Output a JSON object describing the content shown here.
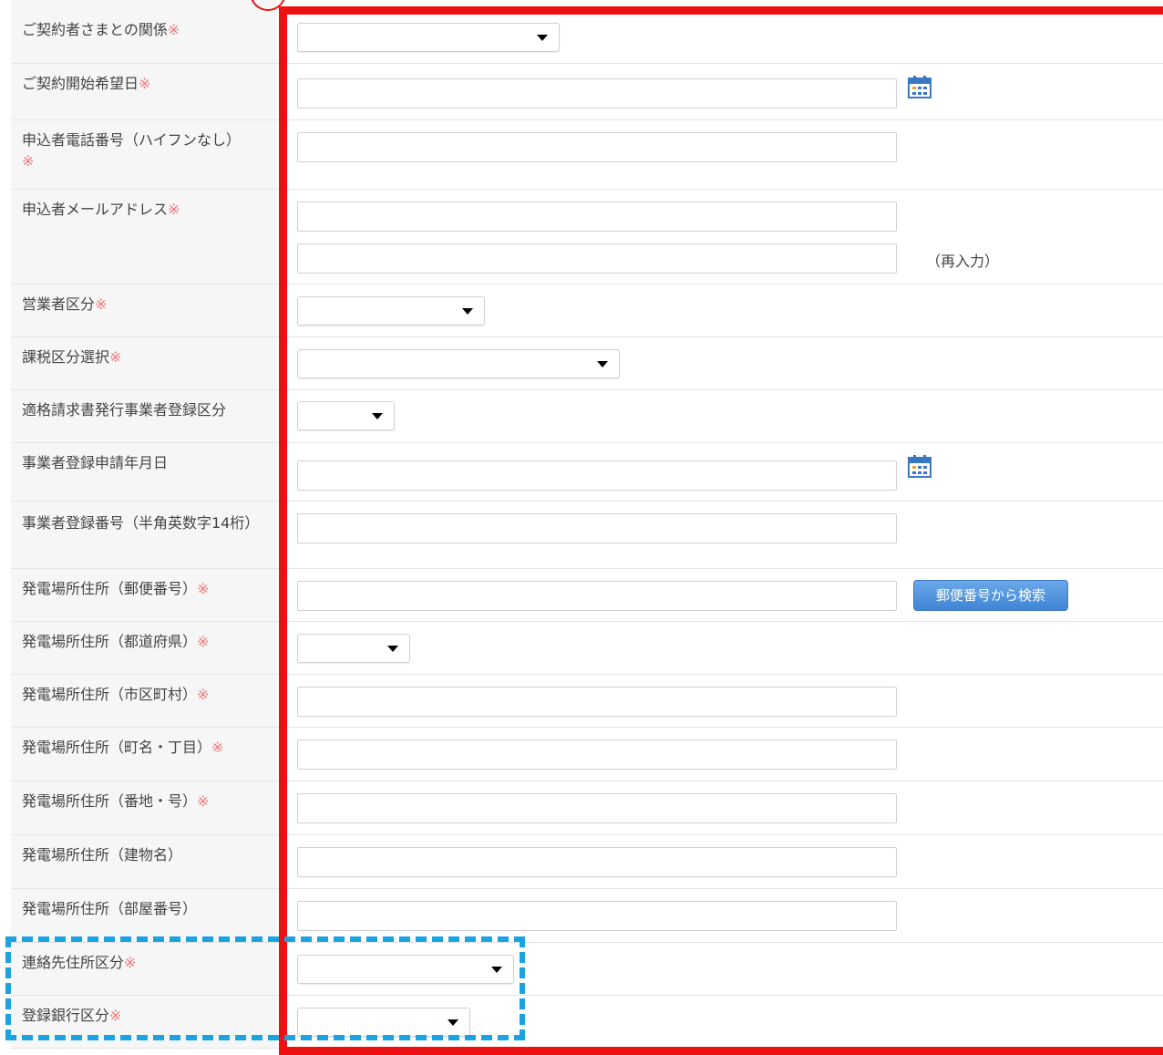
{
  "required_mark": "※",
  "calendar_icon": "calendar-icon",
  "rows": [
    {
      "label": "ご契約者さまとの関係",
      "required": true
    },
    {
      "label": "ご契約開始希望日",
      "required": true
    },
    {
      "label": "申込者電話番号（ハイフンなし）",
      "required": true
    },
    {
      "label": "申込者メールアドレス",
      "required": true,
      "reentry_label": "（再入力）"
    },
    {
      "label": "営業者区分",
      "required": true
    },
    {
      "label": "課税区分選択",
      "required": true
    },
    {
      "label": "適格請求書発行事業者登録区分",
      "required": false
    },
    {
      "label": "事業者登録申請年月日",
      "required": false
    },
    {
      "label": "事業者登録番号（半角英数字14桁）",
      "required": false
    },
    {
      "label": "発電場所住所（郵便番号）",
      "required": true,
      "button_label": "郵便番号から検索"
    },
    {
      "label": "発電場所住所（都道府県）",
      "required": true
    },
    {
      "label": "発電場所住所（市区町村）",
      "required": true
    },
    {
      "label": "発電場所住所（町名・丁目）",
      "required": true
    },
    {
      "label": "発電場所住所（番地・号）",
      "required": true
    },
    {
      "label": "発電場所住所（建物名）",
      "required": false
    },
    {
      "label": "発電場所住所（部屋番号）",
      "required": false
    },
    {
      "label": "連絡先住所区分",
      "required": true
    },
    {
      "label": "登録銀行区分",
      "required": true
    }
  ],
  "colors": {
    "required": "#f07a7a",
    "highlight_red": "#ee1111",
    "highlight_blue": "#1aa3e0",
    "button": "#4a8ede"
  }
}
